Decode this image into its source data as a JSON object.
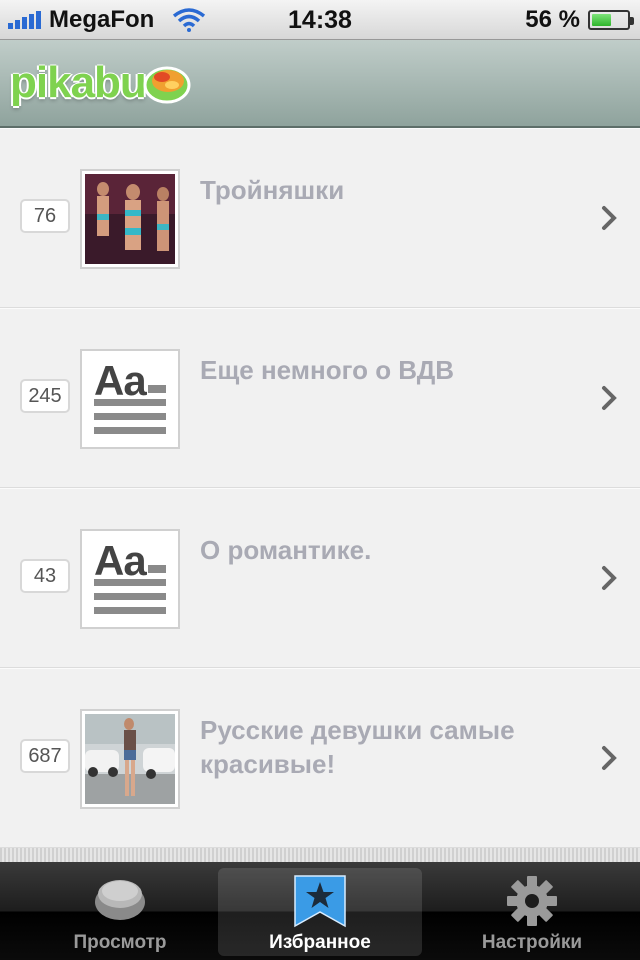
{
  "status_bar": {
    "carrier": "MegaFon",
    "time": "14:38",
    "battery": "56 %",
    "battery_level": 0.56
  },
  "nav": {
    "logo_text": "pikabu"
  },
  "list": {
    "items": [
      {
        "count": "76",
        "title": "Тройняшки",
        "thumb": "photo-women"
      },
      {
        "count": "245",
        "title": "Еще немного о ВДВ",
        "thumb": "text-icon"
      },
      {
        "count": "43",
        "title": "О романтике.",
        "thumb": "text-icon"
      },
      {
        "count": "687",
        "title": "Русские девушки самые красивые!",
        "thumb": "photo-street"
      }
    ]
  },
  "text_icon": {
    "glyph": "Aa"
  },
  "tabbar": {
    "tabs": [
      {
        "label": "Просмотр",
        "icon": "cookie-icon",
        "active": false
      },
      {
        "label": "Избранное",
        "icon": "bookmark-star-icon",
        "active": true
      },
      {
        "label": "Настройки",
        "icon": "gear-icon",
        "active": false
      }
    ]
  },
  "colors": {
    "accent_green": "#7fd24f",
    "title_gray": "#a9aab4",
    "signal_blue": "#2a6ad3",
    "bookmark_blue": "#3a9be6"
  }
}
